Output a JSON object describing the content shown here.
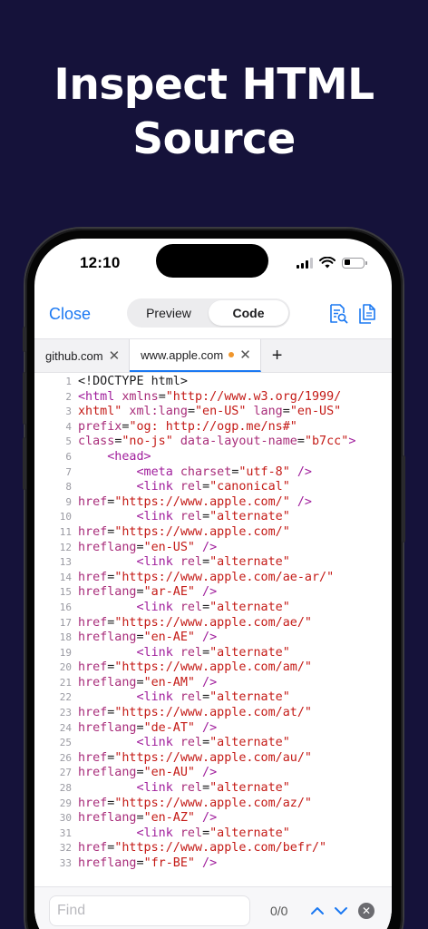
{
  "headline": {
    "line1": "Inspect HTML",
    "line2": "Source"
  },
  "status_bar": {
    "time": "12:10",
    "signal_icon": "signal-icon",
    "wifi_icon": "wifi-icon",
    "battery_icon": "battery-icon"
  },
  "toolbar": {
    "close_label": "Close",
    "segments": [
      {
        "label": "Preview",
        "selected": false
      },
      {
        "label": "Code",
        "selected": true
      }
    ],
    "icons": [
      "document-search-icon",
      "copy-document-icon"
    ]
  },
  "tabs": [
    {
      "label": "github.com",
      "active": false,
      "unsaved_dot": false
    },
    {
      "label": "www.apple.com",
      "active": true,
      "unsaved_dot": true
    }
  ],
  "add_tab_label": "+",
  "code_lines": [
    {
      "n": "1",
      "t": [
        {
          "c": "plain",
          "s": "<!DOCTYPE html>"
        }
      ]
    },
    {
      "n": "2",
      "t": [
        {
          "c": "tag",
          "s": "<html"
        },
        {
          "c": "attr",
          "s": " xmlns"
        },
        {
          "c": "plain",
          "s": "="
        },
        {
          "c": "str",
          "s": "\"http://www.w3.org/1999/"
        }
      ]
    },
    {
      "n": "3",
      "t": [
        {
          "c": "str",
          "s": "xhtml\""
        },
        {
          "c": "attr",
          "s": " xml:lang"
        },
        {
          "c": "plain",
          "s": "="
        },
        {
          "c": "str",
          "s": "\"en-US\""
        },
        {
          "c": "attr",
          "s": " lang"
        },
        {
          "c": "plain",
          "s": "="
        },
        {
          "c": "str",
          "s": "\"en-US\""
        }
      ]
    },
    {
      "n": "4",
      "t": [
        {
          "c": "attr",
          "s": "prefix"
        },
        {
          "c": "plain",
          "s": "="
        },
        {
          "c": "str",
          "s": "\"og: http://ogp.me/ns#\""
        }
      ]
    },
    {
      "n": "5",
      "t": [
        {
          "c": "attr",
          "s": "class"
        },
        {
          "c": "plain",
          "s": "="
        },
        {
          "c": "str",
          "s": "\"no-js\""
        },
        {
          "c": "attr",
          "s": " data-layout-name"
        },
        {
          "c": "plain",
          "s": "="
        },
        {
          "c": "str",
          "s": "\"b7cc\""
        },
        {
          "c": "tag",
          "s": ">"
        }
      ]
    },
    {
      "n": "6",
      "t": [
        {
          "c": "plain",
          "s": "    "
        },
        {
          "c": "tag",
          "s": "<head>"
        }
      ]
    },
    {
      "n": "7",
      "t": [
        {
          "c": "plain",
          "s": "        "
        },
        {
          "c": "tag",
          "s": "<meta"
        },
        {
          "c": "attr",
          "s": " charset"
        },
        {
          "c": "plain",
          "s": "="
        },
        {
          "c": "str",
          "s": "\"utf-8\""
        },
        {
          "c": "tag",
          "s": " />"
        }
      ]
    },
    {
      "n": "8",
      "t": [
        {
          "c": "plain",
          "s": "        "
        },
        {
          "c": "tag",
          "s": "<link"
        },
        {
          "c": "attr",
          "s": " rel"
        },
        {
          "c": "plain",
          "s": "="
        },
        {
          "c": "str",
          "s": "\"canonical\""
        }
      ]
    },
    {
      "n": "9",
      "t": [
        {
          "c": "attr",
          "s": "href"
        },
        {
          "c": "plain",
          "s": "="
        },
        {
          "c": "str",
          "s": "\"https://www.apple.com/\""
        },
        {
          "c": "tag",
          "s": " />"
        }
      ]
    },
    {
      "n": "10",
      "t": [
        {
          "c": "plain",
          "s": "        "
        },
        {
          "c": "tag",
          "s": "<link"
        },
        {
          "c": "attr",
          "s": " rel"
        },
        {
          "c": "plain",
          "s": "="
        },
        {
          "c": "str",
          "s": "\"alternate\""
        }
      ]
    },
    {
      "n": "11",
      "t": [
        {
          "c": "attr",
          "s": "href"
        },
        {
          "c": "plain",
          "s": "="
        },
        {
          "c": "str",
          "s": "\"https://www.apple.com/\""
        }
      ]
    },
    {
      "n": "12",
      "t": [
        {
          "c": "attr",
          "s": "hreflang"
        },
        {
          "c": "plain",
          "s": "="
        },
        {
          "c": "str",
          "s": "\"en-US\""
        },
        {
          "c": "tag",
          "s": " />"
        }
      ]
    },
    {
      "n": "13",
      "t": [
        {
          "c": "plain",
          "s": "        "
        },
        {
          "c": "tag",
          "s": "<link"
        },
        {
          "c": "attr",
          "s": " rel"
        },
        {
          "c": "plain",
          "s": "="
        },
        {
          "c": "str",
          "s": "\"alternate\""
        }
      ]
    },
    {
      "n": "14",
      "t": [
        {
          "c": "attr",
          "s": "href"
        },
        {
          "c": "plain",
          "s": "="
        },
        {
          "c": "str",
          "s": "\"https://www.apple.com/ae-ar/\""
        }
      ]
    },
    {
      "n": "15",
      "t": [
        {
          "c": "attr",
          "s": "hreflang"
        },
        {
          "c": "plain",
          "s": "="
        },
        {
          "c": "str",
          "s": "\"ar-AE\""
        },
        {
          "c": "tag",
          "s": " />"
        }
      ]
    },
    {
      "n": "16",
      "t": [
        {
          "c": "plain",
          "s": "        "
        },
        {
          "c": "tag",
          "s": "<link"
        },
        {
          "c": "attr",
          "s": " rel"
        },
        {
          "c": "plain",
          "s": "="
        },
        {
          "c": "str",
          "s": "\"alternate\""
        }
      ]
    },
    {
      "n": "17",
      "t": [
        {
          "c": "attr",
          "s": "href"
        },
        {
          "c": "plain",
          "s": "="
        },
        {
          "c": "str",
          "s": "\"https://www.apple.com/ae/\""
        }
      ]
    },
    {
      "n": "18",
      "t": [
        {
          "c": "attr",
          "s": "hreflang"
        },
        {
          "c": "plain",
          "s": "="
        },
        {
          "c": "str",
          "s": "\"en-AE\""
        },
        {
          "c": "tag",
          "s": " />"
        }
      ]
    },
    {
      "n": "19",
      "t": [
        {
          "c": "plain",
          "s": "        "
        },
        {
          "c": "tag",
          "s": "<link"
        },
        {
          "c": "attr",
          "s": " rel"
        },
        {
          "c": "plain",
          "s": "="
        },
        {
          "c": "str",
          "s": "\"alternate\""
        }
      ]
    },
    {
      "n": "20",
      "t": [
        {
          "c": "attr",
          "s": "href"
        },
        {
          "c": "plain",
          "s": "="
        },
        {
          "c": "str",
          "s": "\"https://www.apple.com/am/\""
        }
      ]
    },
    {
      "n": "21",
      "t": [
        {
          "c": "attr",
          "s": "hreflang"
        },
        {
          "c": "plain",
          "s": "="
        },
        {
          "c": "str",
          "s": "\"en-AM\""
        },
        {
          "c": "tag",
          "s": " />"
        }
      ]
    },
    {
      "n": "22",
      "t": [
        {
          "c": "plain",
          "s": "        "
        },
        {
          "c": "tag",
          "s": "<link"
        },
        {
          "c": "attr",
          "s": " rel"
        },
        {
          "c": "plain",
          "s": "="
        },
        {
          "c": "str",
          "s": "\"alternate\""
        }
      ]
    },
    {
      "n": "23",
      "t": [
        {
          "c": "attr",
          "s": "href"
        },
        {
          "c": "plain",
          "s": "="
        },
        {
          "c": "str",
          "s": "\"https://www.apple.com/at/\""
        }
      ]
    },
    {
      "n": "24",
      "t": [
        {
          "c": "attr",
          "s": "hreflang"
        },
        {
          "c": "plain",
          "s": "="
        },
        {
          "c": "str",
          "s": "\"de-AT\""
        },
        {
          "c": "tag",
          "s": " />"
        }
      ]
    },
    {
      "n": "25",
      "t": [
        {
          "c": "plain",
          "s": "        "
        },
        {
          "c": "tag",
          "s": "<link"
        },
        {
          "c": "attr",
          "s": " rel"
        },
        {
          "c": "plain",
          "s": "="
        },
        {
          "c": "str",
          "s": "\"alternate\""
        }
      ]
    },
    {
      "n": "26",
      "t": [
        {
          "c": "attr",
          "s": "href"
        },
        {
          "c": "plain",
          "s": "="
        },
        {
          "c": "str",
          "s": "\"https://www.apple.com/au/\""
        }
      ]
    },
    {
      "n": "27",
      "t": [
        {
          "c": "attr",
          "s": "hreflang"
        },
        {
          "c": "plain",
          "s": "="
        },
        {
          "c": "str",
          "s": "\"en-AU\""
        },
        {
          "c": "tag",
          "s": " />"
        }
      ]
    },
    {
      "n": "28",
      "t": [
        {
          "c": "plain",
          "s": "        "
        },
        {
          "c": "tag",
          "s": "<link"
        },
        {
          "c": "attr",
          "s": " rel"
        },
        {
          "c": "plain",
          "s": "="
        },
        {
          "c": "str",
          "s": "\"alternate\""
        }
      ]
    },
    {
      "n": "29",
      "t": [
        {
          "c": "attr",
          "s": "href"
        },
        {
          "c": "plain",
          "s": "="
        },
        {
          "c": "str",
          "s": "\"https://www.apple.com/az/\""
        }
      ]
    },
    {
      "n": "30",
      "t": [
        {
          "c": "attr",
          "s": "hreflang"
        },
        {
          "c": "plain",
          "s": "="
        },
        {
          "c": "str",
          "s": "\"en-AZ\""
        },
        {
          "c": "tag",
          "s": " />"
        }
      ]
    },
    {
      "n": "31",
      "t": [
        {
          "c": "plain",
          "s": "        "
        },
        {
          "c": "tag",
          "s": "<link"
        },
        {
          "c": "attr",
          "s": " rel"
        },
        {
          "c": "plain",
          "s": "="
        },
        {
          "c": "str",
          "s": "\"alternate\""
        }
      ]
    },
    {
      "n": "32",
      "t": [
        {
          "c": "attr",
          "s": "href"
        },
        {
          "c": "plain",
          "s": "="
        },
        {
          "c": "str",
          "s": "\"https://www.apple.com/befr/\""
        }
      ]
    },
    {
      "n": "33",
      "t": [
        {
          "c": "attr",
          "s": "hreflang"
        },
        {
          "c": "plain",
          "s": "="
        },
        {
          "c": "str",
          "s": "\"fr-BE\""
        },
        {
          "c": "tag",
          "s": " />"
        }
      ]
    }
  ],
  "find_bar": {
    "placeholder": "Find",
    "value": "",
    "count": "0/0",
    "icons": [
      "chevron-up-icon",
      "chevron-down-icon",
      "clear-icon"
    ]
  },
  "colors": {
    "background": "#15123a",
    "accent": "#1a78f2",
    "tag": "#a01e9c",
    "string": "#c41a16",
    "dot": "#f0962c"
  }
}
